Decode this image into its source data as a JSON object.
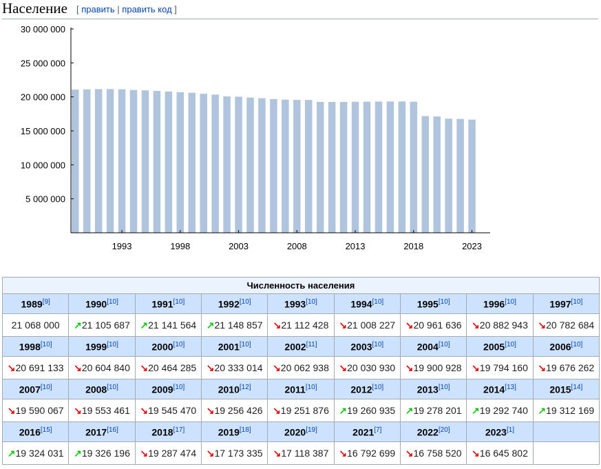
{
  "section": {
    "title": "Население",
    "edit_open": "[",
    "edit_link": "править",
    "edit_sep": "|",
    "edit_code_link": "править код",
    "edit_close": "]"
  },
  "chart_data": {
    "type": "bar",
    "bar_color": "#b0c4de",
    "ylim": [
      0,
      30000000
    ],
    "yticks": [
      "5 000 000",
      "10 000 000",
      "15 000 000",
      "20 000 000",
      "25 000 000",
      "30 000 000"
    ],
    "ytick_values": [
      5000000,
      10000000,
      15000000,
      20000000,
      25000000,
      30000000
    ],
    "xticks": [
      "1993",
      "1998",
      "2003",
      "2008",
      "2013",
      "2018",
      "2023"
    ],
    "categories": [
      "1989",
      "1990",
      "1991",
      "1992",
      "1993",
      "1994",
      "1995",
      "1996",
      "1997",
      "1998",
      "1999",
      "2000",
      "2001",
      "2002",
      "2003",
      "2004",
      "2005",
      "2006",
      "2007",
      "2008",
      "2009",
      "2010",
      "2011",
      "2012",
      "2013",
      "2014",
      "2015",
      "2016",
      "2017",
      "2018",
      "2019",
      "2020",
      "2021",
      "2022",
      "2023"
    ],
    "values": [
      21068000,
      21105687,
      21141564,
      21148857,
      21112428,
      21008227,
      20961636,
      20882943,
      20782684,
      20691133,
      20604840,
      20464285,
      20333014,
      20062938,
      20030930,
      19900928,
      19794160,
      19676262,
      19590067,
      19553461,
      19545470,
      19256426,
      19251876,
      19260935,
      19278201,
      19292740,
      19312169,
      19324031,
      19326196,
      19287474,
      17173335,
      17118387,
      16792699,
      16758520,
      16645802
    ]
  },
  "table": {
    "caption": "Численность населения",
    "colors": {
      "up": "#14c814",
      "down": "#dd1111",
      "header_bg": "#cde2ff",
      "caption_bg": "#eaf3ff"
    },
    "rows": [
      [
        {
          "year": "1989",
          "ref": "[9]",
          "value": "21 068 000",
          "trend": ""
        },
        {
          "year": "1990",
          "ref": "[10]",
          "value": "21 105 687",
          "trend": "up"
        },
        {
          "year": "1991",
          "ref": "[10]",
          "value": "21 141 564",
          "trend": "up"
        },
        {
          "year": "1992",
          "ref": "[10]",
          "value": "21 148 857",
          "trend": "up"
        },
        {
          "year": "1993",
          "ref": "[10]",
          "value": "21 112 428",
          "trend": "down"
        },
        {
          "year": "1994",
          "ref": "[10]",
          "value": "21 008 227",
          "trend": "down"
        },
        {
          "year": "1995",
          "ref": "[10]",
          "value": "20 961 636",
          "trend": "down"
        },
        {
          "year": "1996",
          "ref": "[10]",
          "value": "20 882 943",
          "trend": "down"
        },
        {
          "year": "1997",
          "ref": "[10]",
          "value": "20 782 684",
          "trend": "down"
        }
      ],
      [
        {
          "year": "1998",
          "ref": "[10]",
          "value": "20 691 133",
          "trend": "down"
        },
        {
          "year": "1999",
          "ref": "[10]",
          "value": "20 604 840",
          "trend": "down"
        },
        {
          "year": "2000",
          "ref": "[10]",
          "value": "20 464 285",
          "trend": "down"
        },
        {
          "year": "2001",
          "ref": "[10]",
          "value": "20 333 014",
          "trend": "down"
        },
        {
          "year": "2002",
          "ref": "[11]",
          "value": "20 062 938",
          "trend": "down"
        },
        {
          "year": "2003",
          "ref": "[10]",
          "value": "20 030 930",
          "trend": "down"
        },
        {
          "year": "2004",
          "ref": "[10]",
          "value": "19 900 928",
          "trend": "down"
        },
        {
          "year": "2005",
          "ref": "[10]",
          "value": "19 794 160",
          "trend": "down"
        },
        {
          "year": "2006",
          "ref": "[10]",
          "value": "19 676 262",
          "trend": "down"
        }
      ],
      [
        {
          "year": "2007",
          "ref": "[10]",
          "value": "19 590 067",
          "trend": "down"
        },
        {
          "year": "2008",
          "ref": "[10]",
          "value": "19 553 461",
          "trend": "down"
        },
        {
          "year": "2009",
          "ref": "[10]",
          "value": "19 545 470",
          "trend": "down"
        },
        {
          "year": "2010",
          "ref": "[12]",
          "value": "19 256 426",
          "trend": "down"
        },
        {
          "year": "2011",
          "ref": "[10]",
          "value": "19 251 876",
          "trend": "down"
        },
        {
          "year": "2012",
          "ref": "[10]",
          "value": "19 260 935",
          "trend": "up"
        },
        {
          "year": "2013",
          "ref": "[10]",
          "value": "19 278 201",
          "trend": "up"
        },
        {
          "year": "2014",
          "ref": "[13]",
          "value": "19 292 740",
          "trend": "up"
        },
        {
          "year": "2015",
          "ref": "[14]",
          "value": "19 312 169",
          "trend": "up"
        }
      ],
      [
        {
          "year": "2016",
          "ref": "[15]",
          "value": "19 324 031",
          "trend": "up"
        },
        {
          "year": "2017",
          "ref": "[16]",
          "value": "19 326 196",
          "trend": "up"
        },
        {
          "year": "2018",
          "ref": "[17]",
          "value": "19 287 474",
          "trend": "down"
        },
        {
          "year": "2019",
          "ref": "[18]",
          "value": "17 173 335",
          "trend": "down"
        },
        {
          "year": "2020",
          "ref": "[19]",
          "value": "17 118 387",
          "trend": "down"
        },
        {
          "year": "2021",
          "ref": "[7]",
          "value": "16 792 699",
          "trend": "down"
        },
        {
          "year": "2022",
          "ref": "[20]",
          "value": "16 758 520",
          "trend": "down"
        },
        {
          "year": "2023",
          "ref": "[1]",
          "value": "16 645 802",
          "trend": "down"
        },
        {
          "year": "",
          "ref": "",
          "value": "",
          "trend": ""
        }
      ]
    ]
  }
}
